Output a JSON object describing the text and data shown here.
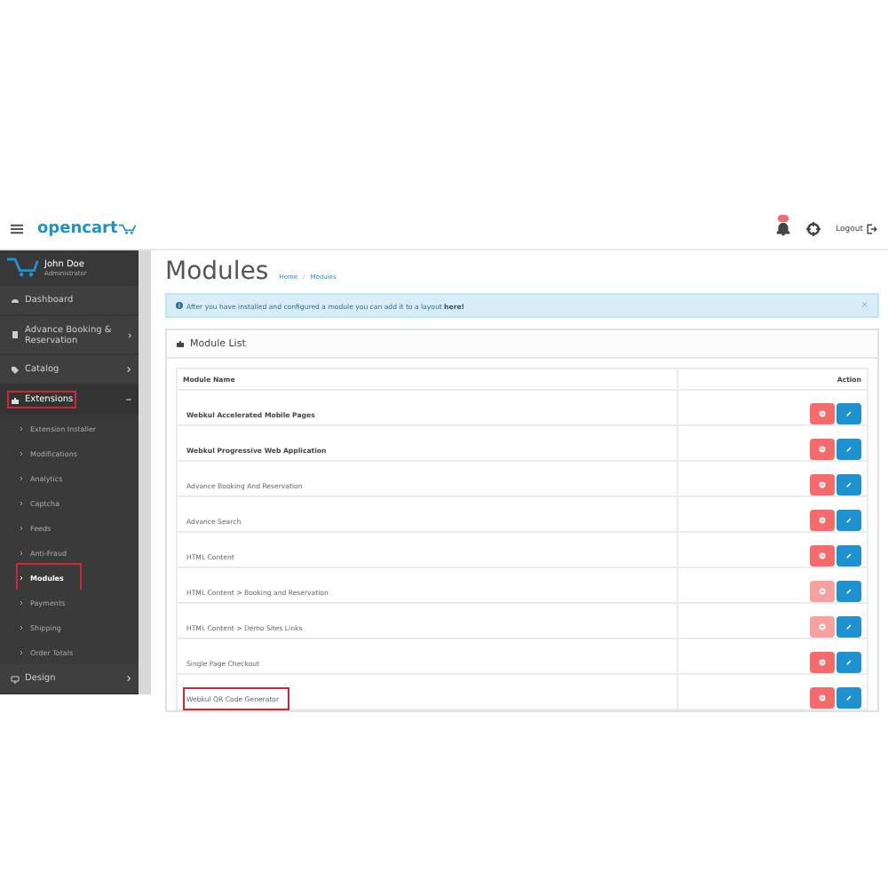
{
  "header": {
    "logo": "opencart",
    "notification_badge": true,
    "logout": "Logout"
  },
  "user": {
    "name": "John Doe",
    "role": "Administrator"
  },
  "sidebar": {
    "items": [
      {
        "label": "Dashboard",
        "expandable": false,
        "expanded": false,
        "highlighted": false
      },
      {
        "label": "Advance Booking & Reservation",
        "expandable": true,
        "expanded": false,
        "highlighted": false
      },
      {
        "label": "Catalog",
        "expandable": true,
        "expanded": false,
        "highlighted": false
      },
      {
        "label": "Extensions",
        "expandable": true,
        "expanded": true,
        "highlighted": true,
        "children": [
          {
            "label": "Extension Installer",
            "selected": false,
            "highlighted": false
          },
          {
            "label": "Modifications",
            "selected": false,
            "highlighted": false
          },
          {
            "label": "Analytics",
            "selected": false,
            "highlighted": false
          },
          {
            "label": "Captcha",
            "selected": false,
            "highlighted": false
          },
          {
            "label": "Feeds",
            "selected": false,
            "highlighted": false
          },
          {
            "label": "Anti-Fraud",
            "selected": false,
            "highlighted": false
          },
          {
            "label": "Modules",
            "selected": true,
            "highlighted": true
          },
          {
            "label": "Payments",
            "selected": false,
            "highlighted": false
          },
          {
            "label": "Shipping",
            "selected": false,
            "highlighted": false
          },
          {
            "label": "Order Totals",
            "selected": false,
            "highlighted": false
          }
        ]
      },
      {
        "label": "Design",
        "expandable": true,
        "expanded": false,
        "highlighted": false
      }
    ]
  },
  "page": {
    "title": "Modules",
    "breadcrumb": [
      "Home",
      "Modules"
    ],
    "breadcrumb_separator": "/"
  },
  "alert": {
    "text": "After you have installed and configured a module you can add it to a layout ",
    "link": "here!",
    "close": "×"
  },
  "panel": {
    "title": "Module List"
  },
  "table": {
    "columns": [
      "Module Name",
      "Action"
    ],
    "rows": [
      {
        "name": "Webkul Accelerated Mobile Pages",
        "bold": true,
        "highlighted": false,
        "delete_disabled": false
      },
      {
        "name": "Webkul Progressive Web Application",
        "bold": true,
        "highlighted": false,
        "delete_disabled": false
      },
      {
        "name": "Advance Booking And Reservation",
        "bold": false,
        "highlighted": false,
        "delete_disabled": false
      },
      {
        "name": "Advance Search",
        "bold": false,
        "highlighted": false,
        "delete_disabled": false
      },
      {
        "name": "HTML Content",
        "bold": false,
        "highlighted": false,
        "delete_disabled": false
      },
      {
        "name": "HTML Content > Booking and Reservation",
        "bold": false,
        "highlighted": false,
        "delete_disabled": true
      },
      {
        "name": "HTML Content > Demo Sites Links",
        "bold": false,
        "highlighted": false,
        "delete_disabled": true
      },
      {
        "name": "Single Page Checkout",
        "bold": false,
        "highlighted": false,
        "delete_disabled": false
      },
      {
        "name": "Webkul QR Code Generator",
        "bold": false,
        "highlighted": true,
        "delete_disabled": false
      }
    ]
  }
}
